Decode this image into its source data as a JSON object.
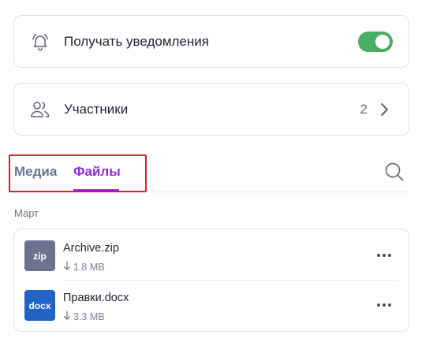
{
  "notifications": {
    "label": "Получать уведомления",
    "icon": "bell-icon",
    "enabled": true,
    "toggle_color": "#4aad66"
  },
  "participants": {
    "label": "Участники",
    "icon": "users-icon",
    "count": "2"
  },
  "tabs": {
    "items": [
      {
        "label": "Медиа",
        "active": false
      },
      {
        "label": "Файлы",
        "active": true
      }
    ],
    "active_color": "#8b2bd6"
  },
  "files_section": {
    "month": "Март",
    "files": [
      {
        "thumb": "zip",
        "name": "Archive.zip",
        "size": "1.8 MB",
        "thumb_color": "#6b7390"
      },
      {
        "thumb": "docx",
        "name": "Правки.docx",
        "size": "3.3 MB",
        "thumb_color": "#2363c6"
      }
    ]
  }
}
